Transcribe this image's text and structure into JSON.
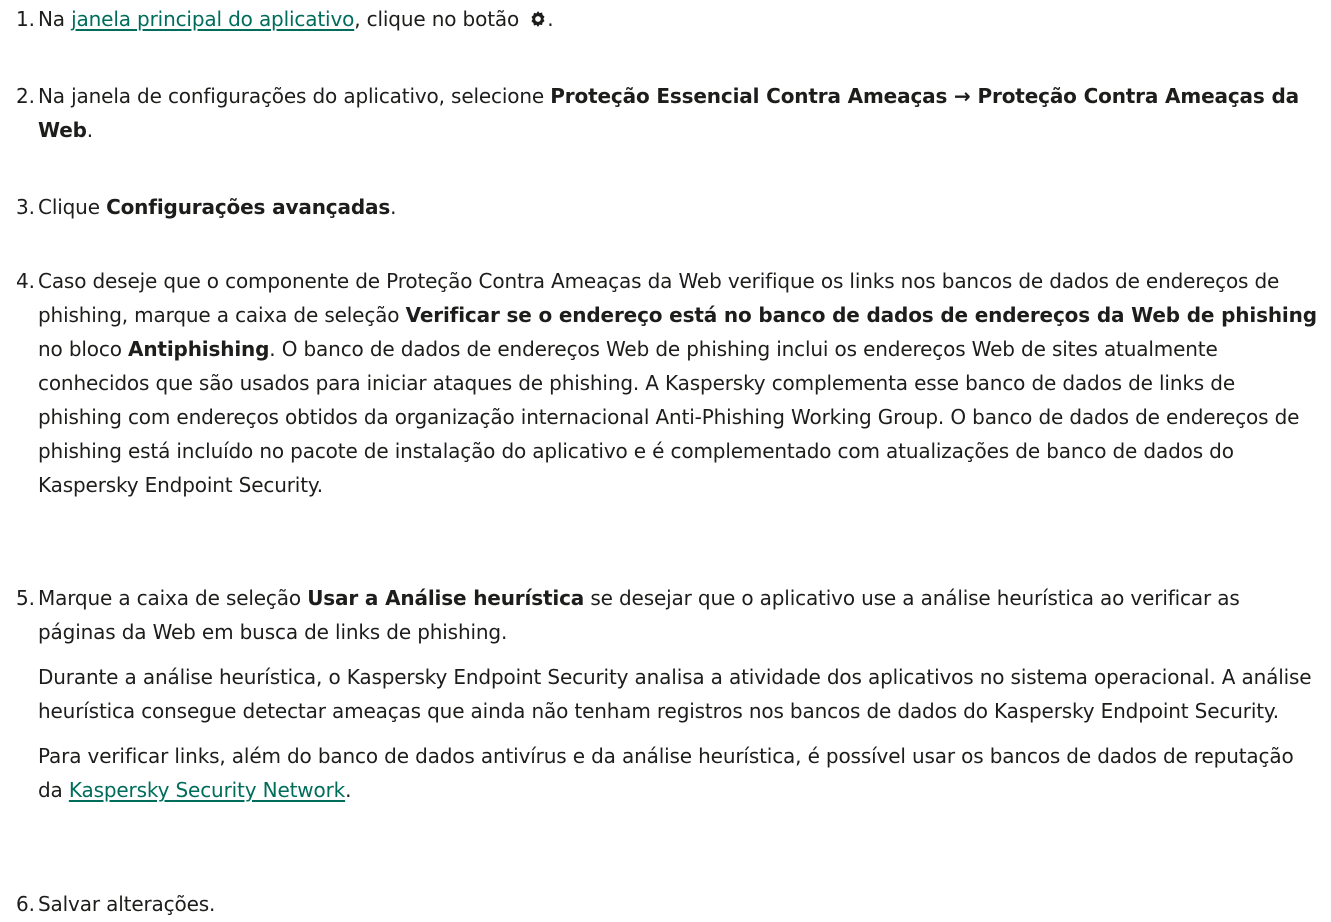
{
  "steps": [
    {
      "num": "1.",
      "t1": "Na ",
      "link": "janela principal do aplicativo",
      "t2": ", clique no botão ",
      "icon": "gear-icon",
      "t3": "."
    },
    {
      "num": "2.",
      "t1": "Na janela de configurações do aplicativo, selecione ",
      "b1": "Proteção Essencial Contra Ameaças → Proteção Contra Ameaças da Web",
      "t2": "."
    },
    {
      "num": "3.",
      "t1": "Clique ",
      "b1": "Configurações avançadas",
      "t2": "."
    },
    {
      "num": "4.",
      "t1": "Caso deseje que o componente de Proteção Contra Ameaças da Web verifique os links nos bancos de dados de endereços de phishing, marque a caixa de seleção ",
      "b1": "Verificar se o endereço está no banco de dados de endereços da Web de phishing",
      "t2": " no bloco ",
      "b2": "Antiphishing",
      "t3": ". O banco de dados de endereços Web de phishing inclui os endereços Web de sites atualmente conhecidos que são usados para iniciar ataques de phishing. A Kaspersky complementa esse banco de dados de links de phishing com endereços obtidos da organização internacional Anti-Phishing Working Group. O banco de dados de endereços de phishing está incluído no pacote de instalação do aplicativo e é complementado com atualizações de banco de dados do Kaspersky Endpoint Security."
    },
    {
      "num": "5.",
      "t1": "Marque a caixa de seleção ",
      "b1": "Usar a Análise heurística",
      "t2": " se desejar que o aplicativo use a análise heurística ao verificar as páginas da Web em busca de links de phishing.",
      "para2": "Durante a análise heurística, o Kaspersky Endpoint Security analisa a atividade dos aplicativos no sistema operacional. A análise heurística consegue detectar ameaças que ainda não tenham registros nos bancos de dados do Kaspersky Endpoint Security.",
      "p3a": "Para verificar links, além do banco de dados antivírus e da análise heurística, é possível usar os bancos de dados de reputação da ",
      "link": "Kaspersky Security Network",
      "p3b": "."
    },
    {
      "num": "6.",
      "t1": "Salvar alterações."
    }
  ],
  "colors": {
    "link": "#006d5b",
    "text": "#1d1d1b"
  }
}
